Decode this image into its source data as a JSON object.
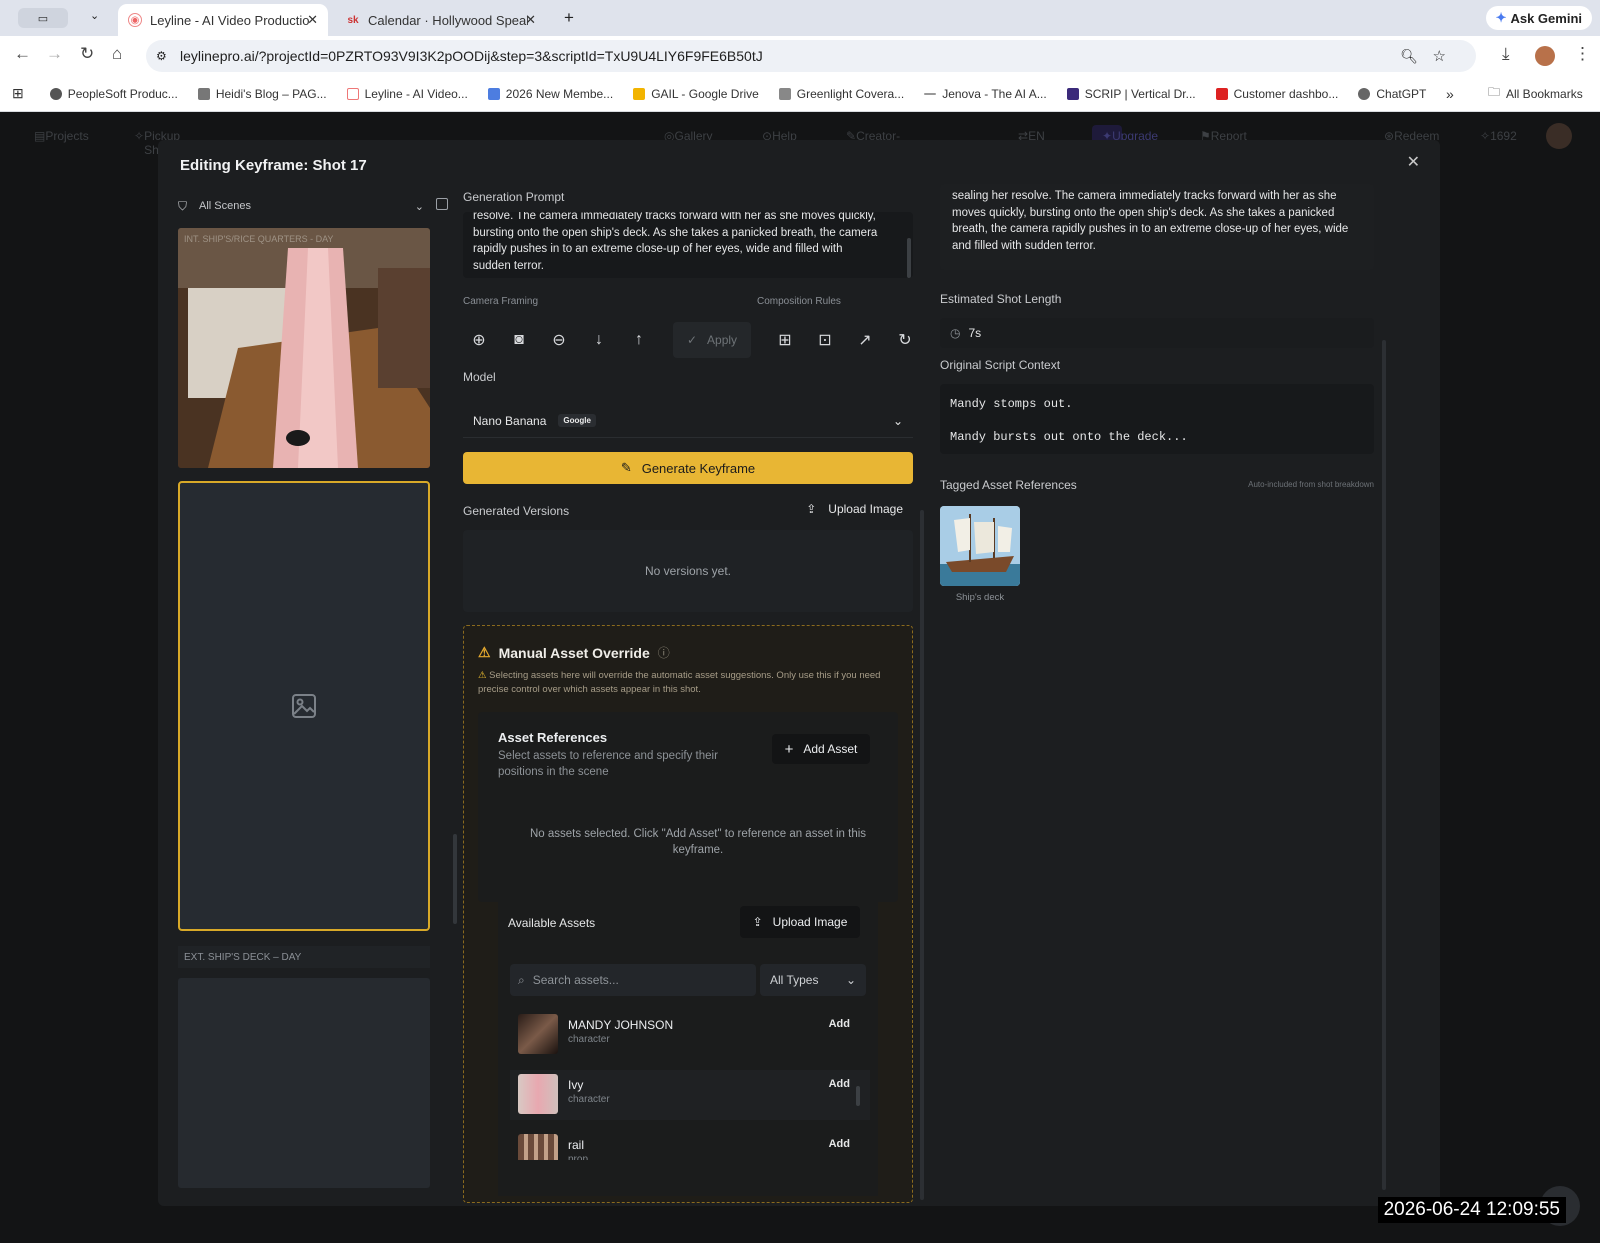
{
  "browser": {
    "tabs": [
      {
        "title": "Leyline - AI Video Production",
        "active": true
      },
      {
        "title": "Calendar · Hollywood Speake",
        "active": false
      }
    ],
    "ask_gemini": "Ask Gemini",
    "url": "leylinepro.ai/?projectId=0PZRTO93V9I3K2pOODij&step=3&scriptId=TxU9U4LIY6F9FE6B50tJ",
    "bookmarks": [
      "PeopleSoft Produc...",
      "Heidi's Blog – PAG...",
      "Leyline - AI Video...",
      "2026 New Membe...",
      "GAIL - Google Drive",
      "Greenlight Covera...",
      "Jenova - The AI A...",
      "SCRIP | Vertical Dr...",
      "Customer dashbo...",
      "ChatGPT"
    ],
    "all_bookmarks": "All Bookmarks"
  },
  "app_bar": {
    "projects": "Projects",
    "pickup": "Pickup Shots",
    "gallery": "Gallery",
    "help": "Help",
    "creator": "Creator-in-Residence",
    "lang": "EN",
    "upgrade": "Upgrade",
    "report": "Report Bug & Earn",
    "redeem": "Redeem",
    "credits": "1692"
  },
  "modal": {
    "title": "Editing Keyframe: Shot 17",
    "scene_filter": "All Scenes",
    "scene1_label": "INT. SHIP'S/RICE QUARTERS - DAY",
    "scene2_label": "EXT. SHIP'S DECK – DAY",
    "generation_prompt_label": "Generation Prompt",
    "generation_prompt": "resolve. The camera immediately tracks forward with her as she moves quickly, bursting onto the open ship's deck. As she takes a panicked breath, the camera rapidly pushes in to an extreme close-up of her eyes, wide and filled with sudden terror.",
    "camera_framing_label": "Camera Framing",
    "composition_rules_label": "Composition Rules",
    "apply_label": "Apply",
    "model_label": "Model",
    "model_value": "Nano Banana",
    "model_badge": "Google",
    "generate_label": "Generate Keyframe",
    "generated_versions_label": "Generated Versions",
    "upload_image_label": "Upload Image",
    "no_versions": "No versions yet.",
    "override": {
      "title": "Manual Asset Override",
      "warning": "Selecting assets here will override the automatic asset suggestions. Only use this if you need precise control over which assets appear in this shot.",
      "asset_refs_title": "Asset References",
      "asset_refs_sub": "Select assets to reference and specify their positions in the scene",
      "add_asset": "Add Asset",
      "no_assets": "No assets selected. Click \"Add Asset\" to reference an asset in this keyframe.",
      "available_assets": "Available Assets",
      "upload_image": "Upload Image",
      "search_placeholder": "Search assets...",
      "type_filter": "All Types",
      "assets": [
        {
          "name": "MANDY JOHNSON",
          "type": "character",
          "action": "Add"
        },
        {
          "name": "Ivy",
          "type": "character",
          "action": "Add"
        },
        {
          "name": "rail",
          "type": "prop",
          "action": "Add"
        }
      ]
    },
    "right": {
      "prompt_text": "sealing her resolve. The camera immediately tracks forward with her as she moves quickly, bursting onto the open ship's deck. As she takes a panicked breath, the camera rapidly pushes in to an extreme close-up of her eyes, wide and filled with sudden terror.",
      "est_length_label": "Estimated Shot Length",
      "est_length": "7s",
      "script_context_label": "Original Script Context",
      "script_context": "Mandy stomps out.\n\nMandy bursts out onto the deck...",
      "tagged_label": "Tagged Asset References",
      "auto_note": "Auto-included from shot breakdown",
      "tagged_asset": "Ship's deck"
    }
  },
  "timestamp": "2026-06-24 12:09:55",
  "colors": {
    "accent": "#e8b634",
    "background": "#1c1e20"
  }
}
